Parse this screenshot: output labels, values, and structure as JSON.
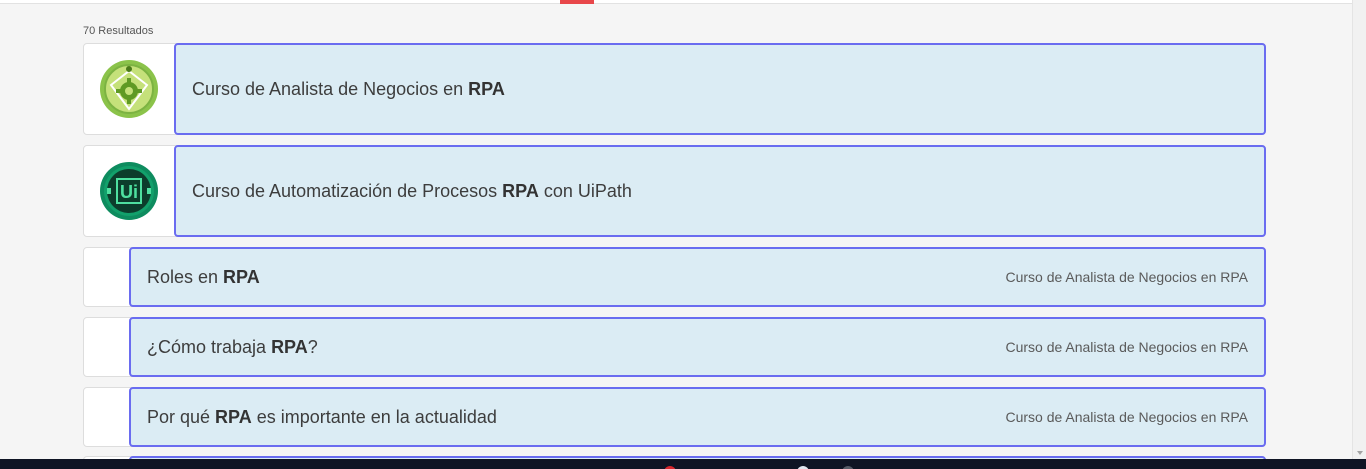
{
  "results_count": "70 Resultados",
  "results": [
    {
      "type": "course",
      "icon": "rpa-business-analyst-logo-icon",
      "pre": "Curso de Analista de Negocios en ",
      "bold": "RPA",
      "post": "",
      "course": ""
    },
    {
      "type": "course",
      "icon": "uipath-logo-icon",
      "pre": "Curso de Automatización de Procesos ",
      "bold": "RPA",
      "post": " con UiPath",
      "course": ""
    },
    {
      "type": "lesson",
      "pre": "Roles en ",
      "bold": "RPA",
      "post": "",
      "course": "Curso de Analista de Negocios en RPA"
    },
    {
      "type": "lesson",
      "pre": "¿Cómo trabaja ",
      "bold": "RPA",
      "post": "?",
      "course": "Curso de Analista de Negocios en RPA"
    },
    {
      "type": "lesson",
      "pre": "Por qué ",
      "bold": "RPA",
      "post": " es importante en la actualidad",
      "course": "Curso de Analista de Negocios en RPA"
    }
  ],
  "colors": {
    "panel_bg": "#dbecf4",
    "panel_border": "#6a6cf0",
    "accent_red": "#e8474a",
    "taskbar": "#0f1424"
  }
}
